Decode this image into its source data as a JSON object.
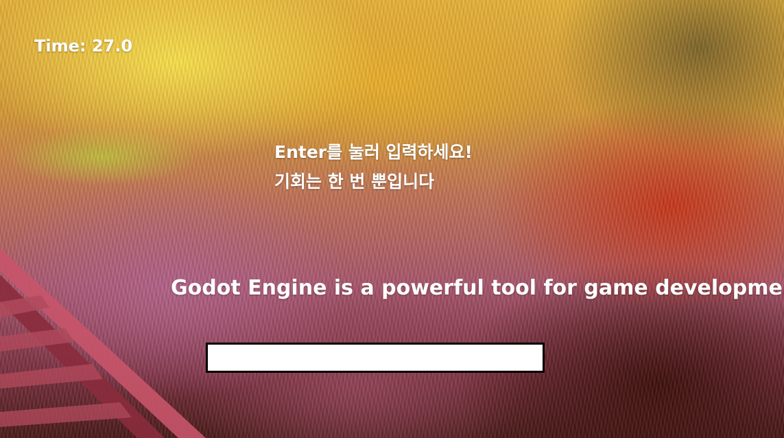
{
  "hud": {
    "timer": "Time: 27.0"
  },
  "prompt": {
    "line1": "Enter를 눌러 입력하세요!",
    "line2": "기회는 한 번 뿐입니다"
  },
  "sentence": "Godot Engine is a powerful tool for game development.",
  "input": {
    "value": "",
    "placeholder": ""
  },
  "colors": {
    "text": "#ffffff",
    "input_border": "#000000",
    "input_background": "#ffffff"
  }
}
